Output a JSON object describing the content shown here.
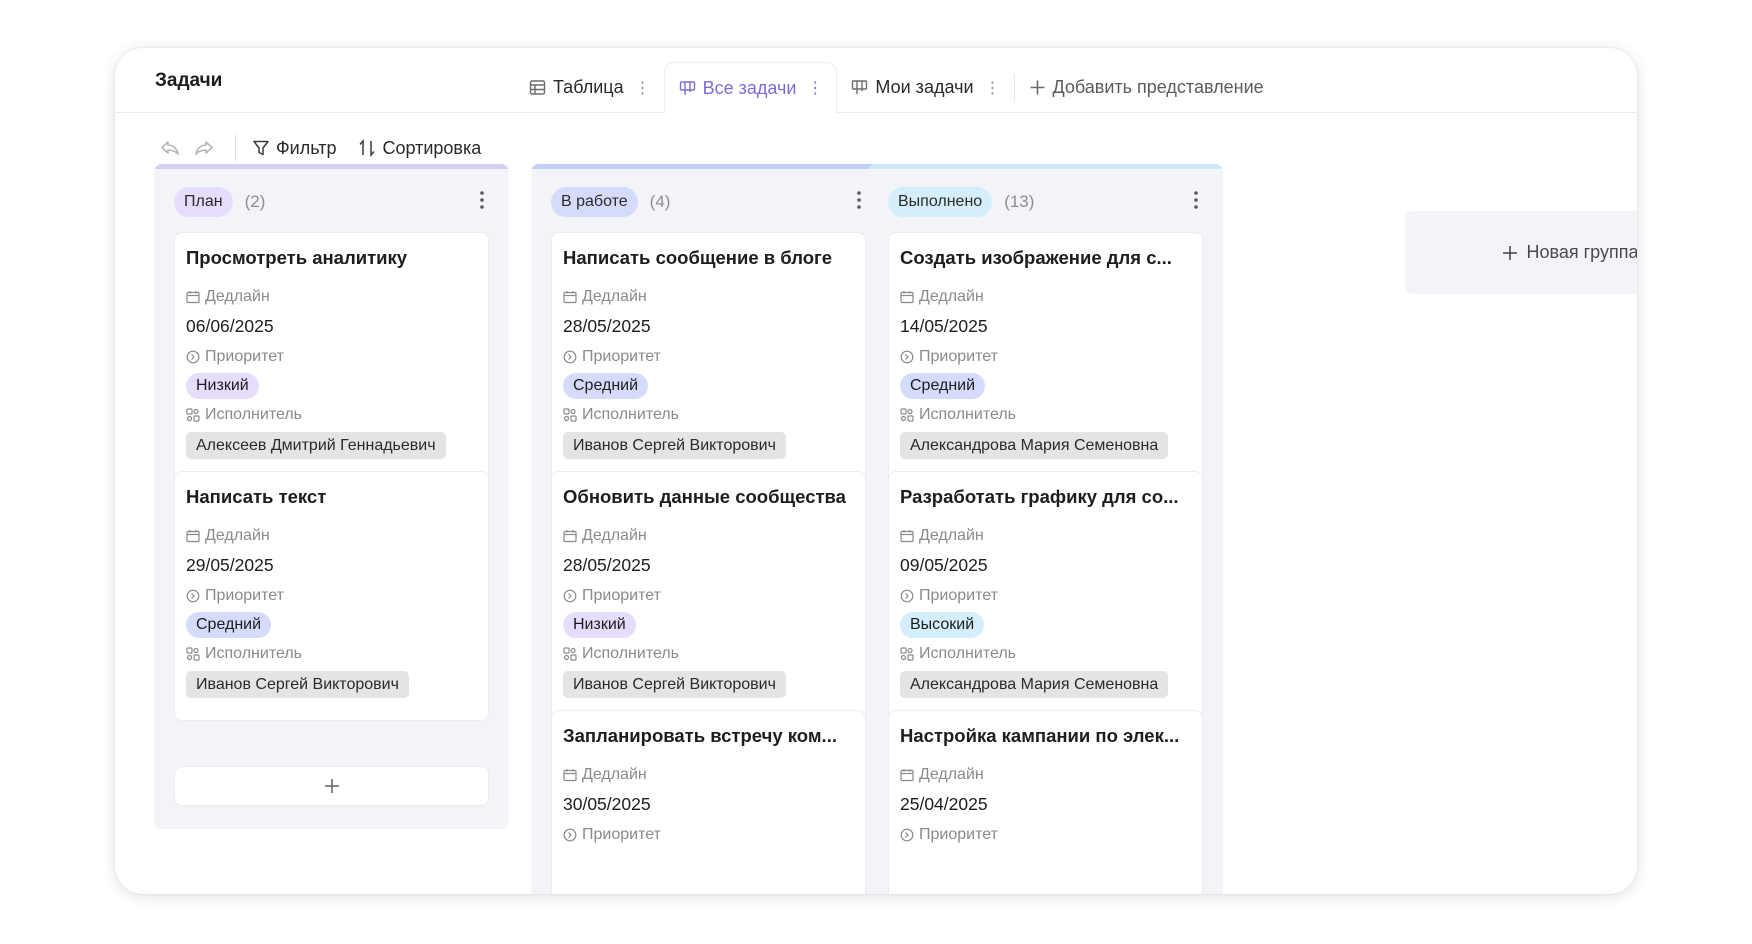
{
  "header": {
    "title": "Задачи",
    "tabs": [
      {
        "label": "Таблица",
        "icon": "table-icon",
        "active": false
      },
      {
        "label": "Все задачи",
        "icon": "kanban-icon",
        "active": true
      },
      {
        "label": "Мои задачи",
        "icon": "kanban-icon",
        "active": false
      }
    ],
    "add_view_label": "Добавить представление"
  },
  "toolbar": {
    "filter_label": "Фильтр",
    "sort_label": "Сортировка"
  },
  "field_labels": {
    "deadline": "Дедлайн",
    "priority": "Приоритет",
    "assignee": "Исполнитель"
  },
  "colors": {
    "accent": "#7e6bd6",
    "column_bg": "#f3f4f7",
    "priority_low": "#e6dcfb",
    "priority_medium": "#d5dcfb",
    "priority_high": "#d5eefb"
  },
  "columns": [
    {
      "name": "План",
      "count": "(2)",
      "pill_color": "#e6dcfb",
      "bar_color": "#d8cef5",
      "cards": [
        {
          "title": "Просмотреть аналитику",
          "deadline": "06/06/2025",
          "priority": "Низкий",
          "priority_color": "#e6dcfb",
          "assignee": "Алексеев Дмитрий Геннадьевич"
        },
        {
          "title": "Написать текст",
          "deadline": "29/05/2025",
          "priority": "Средний",
          "priority_color": "#d5dcfb",
          "assignee": "Иванов Сергей Викторович"
        }
      ]
    },
    {
      "name": "В работе",
      "count": "(4)",
      "pill_color": "#d5dcfb",
      "bar_color": "#c4cdf5",
      "cards": [
        {
          "title": "Написать сообщение в блоге",
          "deadline": "28/05/2025",
          "priority": "Средний",
          "priority_color": "#d5dcfb",
          "assignee": "Иванов Сергей Викторович"
        },
        {
          "title": "Обновить данные сообщества",
          "deadline": "28/05/2025",
          "priority": "Низкий",
          "priority_color": "#e6dcfb",
          "assignee": "Иванов Сергей Викторович"
        },
        {
          "title": "Запланировать встречу ком...",
          "deadline": "30/05/2025"
        }
      ]
    },
    {
      "name": "Выполнено",
      "count": "(13)",
      "pill_color": "#d5eefb",
      "bar_color": "#cfe8f7",
      "cards": [
        {
          "title": "Создать изображение для с...",
          "deadline": "14/05/2025",
          "priority": "Средний",
          "priority_color": "#d5dcfb",
          "assignee": "Александрова Мария Семеновна"
        },
        {
          "title": "Разработать графику для со...",
          "deadline": "09/05/2025",
          "priority": "Высокий",
          "priority_color": "#d5eefb",
          "assignee": "Александрова Мария Семеновна"
        },
        {
          "title": "Настройка кампании по элек...",
          "deadline": "25/04/2025"
        }
      ]
    }
  ],
  "new_group_label": "Новая группа"
}
